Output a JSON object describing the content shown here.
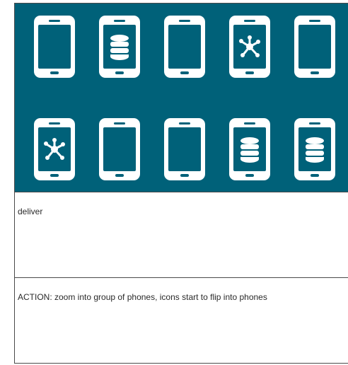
{
  "panel": {
    "background_color": "#006179",
    "phone_color": "#ffffff",
    "phones": [
      {
        "screen_icon": "blank"
      },
      {
        "screen_icon": "database-icon"
      },
      {
        "screen_icon": "blank"
      },
      {
        "screen_icon": "network-hub-icon"
      },
      {
        "screen_icon": "blank"
      },
      {
        "screen_icon": "network-hub-icon"
      },
      {
        "screen_icon": "blank"
      },
      {
        "screen_icon": "blank"
      },
      {
        "screen_icon": "database-icon"
      },
      {
        "screen_icon": "database-icon"
      }
    ]
  },
  "captions": {
    "label": "deliver",
    "action": "ACTION: zoom into group of phones, icons start to flip into phones"
  }
}
